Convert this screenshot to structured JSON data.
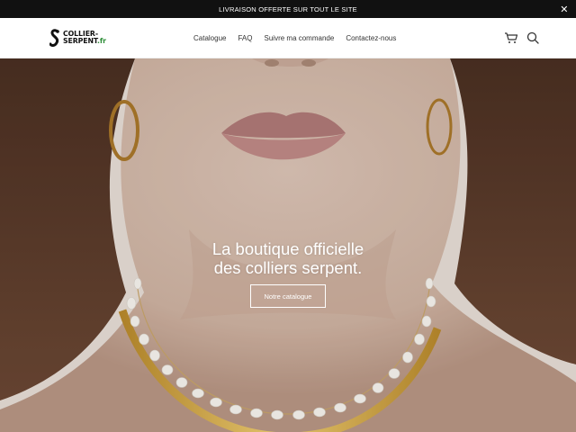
{
  "announcement": {
    "text": "LIVRAISON OFFERTE SUR TOUT LE SITE",
    "close_icon": "close-icon"
  },
  "header": {
    "logo": {
      "line1": "COLLIER-",
      "line2": "SERPENT",
      "tld": ".fr",
      "icon": "snake-logo-icon"
    },
    "nav": [
      "Catalogue",
      "FAQ",
      "Suivre ma commande",
      "Contactez-nous"
    ],
    "icons": [
      "cart-icon",
      "search-icon"
    ]
  },
  "hero": {
    "title_line1": "La boutique officielle",
    "title_line2": "des colliers serpent.",
    "button_label": "Notre catalogue"
  },
  "colors": {
    "announcement_bg": "#111111",
    "logo_accent": "#2f8f3a",
    "hero_text": "#ffffff"
  }
}
